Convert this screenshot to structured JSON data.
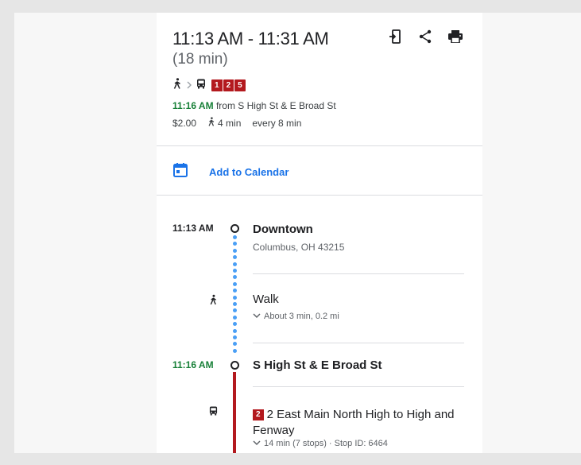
{
  "summary": {
    "time_range": "11:13 AM - 11:31 AM",
    "duration": "(18 min)",
    "routes": [
      "1",
      "2",
      "5"
    ],
    "depart_time": "11:16 AM",
    "depart_from": "from S High St & E Broad St",
    "fare": "$2.00",
    "walk_time": "4 min",
    "frequency": "every 8 min",
    "actions": [
      "send-to-phone-icon",
      "share-icon",
      "print-icon"
    ]
  },
  "calendar": {
    "label": "Add to Calendar"
  },
  "timeline": {
    "origin": {
      "time": "11:13 AM",
      "name": "Downtown",
      "address": "Columbus, OH 43215"
    },
    "walk": {
      "title": "Walk",
      "detail": "About 3 min, 0.2 mi"
    },
    "board_stop": {
      "time": "11:16 AM",
      "name": "S High St & E Broad St"
    },
    "bus": {
      "route": "2",
      "title": "2 East Main North High to High and Fenway",
      "detail": "14 min (7 stops) · Stop ID: 6464"
    }
  },
  "colors": {
    "route_red": "#b3191e",
    "depart_green": "#188038",
    "link_blue": "#1a73e8",
    "walk_dot_blue": "#4a9ff5"
  }
}
